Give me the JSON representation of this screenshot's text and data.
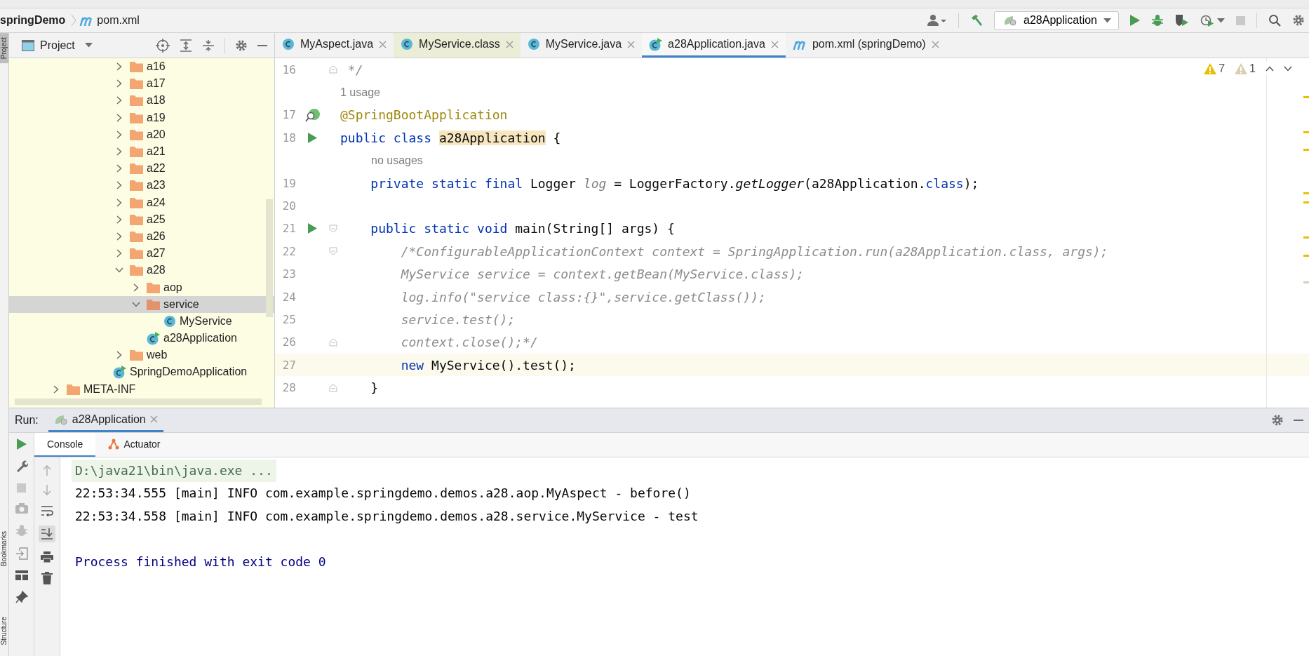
{
  "navbar": {
    "breadcrumbs": [
      {
        "label": "springDemo",
        "kind": "project"
      },
      {
        "label": "pom.xml",
        "kind": "maven"
      }
    ],
    "run_config": {
      "label": "a28Application"
    }
  },
  "side_stripe": {
    "top": [
      {
        "label": "Project",
        "selected": true
      }
    ],
    "bottom": [
      {
        "label": "Bookmarks",
        "selected": false
      },
      {
        "label": "Structure",
        "selected": false
      }
    ]
  },
  "project_panel": {
    "title": "Project",
    "tree_sections": [
      {
        "items": [
          {
            "label": "a16",
            "kind": "folder",
            "expanded": false,
            "selected": false
          },
          {
            "label": "a17",
            "kind": "folder",
            "expanded": false,
            "selected": false
          },
          {
            "label": "a18",
            "kind": "folder",
            "expanded": false,
            "selected": false
          },
          {
            "label": "a19",
            "kind": "folder",
            "expanded": false,
            "selected": false
          },
          {
            "label": "a20",
            "kind": "folder",
            "expanded": false,
            "selected": false
          },
          {
            "label": "a21",
            "kind": "folder",
            "expanded": false,
            "selected": false
          },
          {
            "label": "a22",
            "kind": "folder",
            "expanded": false,
            "selected": false
          },
          {
            "label": "a23",
            "kind": "folder",
            "expanded": false,
            "selected": false
          },
          {
            "label": "a24",
            "kind": "folder",
            "expanded": false,
            "selected": false
          },
          {
            "label": "a25",
            "kind": "folder",
            "expanded": false,
            "selected": false
          },
          {
            "label": "a26",
            "kind": "folder",
            "expanded": false,
            "selected": false
          },
          {
            "label": "a27",
            "kind": "folder",
            "expanded": false,
            "selected": false
          },
          {
            "label": "a28",
            "kind": "folder",
            "expanded": true,
            "selected": false,
            "children": [
              {
                "label": "aop",
                "kind": "folder",
                "expanded": false,
                "selected": false
              },
              {
                "label": "service",
                "kind": "folder",
                "expanded": true,
                "selected": true,
                "children": [
                  {
                    "label": "MyService",
                    "kind": "class",
                    "selected": false
                  }
                ]
              },
              {
                "label": "a28Application",
                "kind": "app",
                "selected": false
              }
            ]
          },
          {
            "label": "web",
            "kind": "folder",
            "expanded": false,
            "selected": false
          }
        ]
      },
      {
        "items": [
          {
            "label": "SpringDemoApplication",
            "kind": "app",
            "selected": false
          }
        ]
      },
      {
        "items": [
          {
            "label": "META-INF",
            "kind": "folder",
            "expanded": false,
            "selected": false
          }
        ]
      }
    ]
  },
  "editor": {
    "tabs": [
      {
        "label": "MyAspect.java",
        "kind": "class",
        "selected": false,
        "library": false
      },
      {
        "label": "MyService.class",
        "kind": "class",
        "selected": false,
        "library": true
      },
      {
        "label": "MyService.java",
        "kind": "class",
        "selected": false,
        "library": false
      },
      {
        "label": "a28Application.java",
        "kind": "app",
        "selected": true,
        "library": false
      },
      {
        "label": "pom.xml (springDemo)",
        "kind": "maven",
        "selected": false,
        "library": false
      }
    ],
    "problems": [
      {
        "count": "7",
        "kind": "warning"
      },
      {
        "count": "1",
        "kind": "weak"
      }
    ],
    "lines": [
      {
        "kind": "code",
        "number": "16",
        "fold": {
          "kind": "end"
        },
        "current": false,
        "tokens": [
          {
            "text": " */",
            "kind": "comment"
          }
        ]
      },
      {
        "kind": "hint",
        "text": "1 usage",
        "indented": false
      },
      {
        "kind": "code",
        "number": "17",
        "gutter": {
          "kind": "bean"
        },
        "current": false,
        "tokens": [
          {
            "text": "@SpringBootApplication",
            "kind": "annotation"
          }
        ]
      },
      {
        "kind": "code",
        "number": "18",
        "gutter": {
          "kind": "run"
        },
        "current": false,
        "tokens": [
          {
            "text": "public class ",
            "kind": "keyword"
          },
          {
            "text": "a28Application",
            "kind": "highlight"
          },
          {
            "text": " {",
            "kind": "plain"
          }
        ]
      },
      {
        "kind": "hint",
        "text": "no usages",
        "indented": true
      },
      {
        "kind": "code",
        "number": "19",
        "current": false,
        "tokens": [
          {
            "text": "    private static final ",
            "kind": "keyword"
          },
          {
            "text": "Logger ",
            "kind": "plain"
          },
          {
            "text": "log",
            "kind": "field"
          },
          {
            "text": " = LoggerFactory.",
            "kind": "plain"
          },
          {
            "text": "getLogger",
            "kind": "static"
          },
          {
            "text": "(a28Application.",
            "kind": "plain"
          },
          {
            "text": "class",
            "kind": "keyword"
          },
          {
            "text": ");",
            "kind": "plain"
          }
        ]
      },
      {
        "kind": "code",
        "number": "20",
        "current": false
      },
      {
        "kind": "code",
        "number": "21",
        "gutter": {
          "kind": "run"
        },
        "fold": {
          "kind": "start"
        },
        "current": false,
        "tokens": [
          {
            "text": "    public static void ",
            "kind": "keyword"
          },
          {
            "text": "main(String[] args) {",
            "kind": "plain"
          }
        ]
      },
      {
        "kind": "code",
        "number": "22",
        "fold": {
          "kind": "start"
        },
        "current": false,
        "tokens": [
          {
            "text": "        /*ConfigurableApplicationContext context = SpringApplication.run(a28Application.class, args);",
            "kind": "comment"
          }
        ]
      },
      {
        "kind": "code",
        "number": "23",
        "current": false,
        "tokens": [
          {
            "text": "        MyService service = context.getBean(MyService.class);",
            "kind": "comment"
          }
        ]
      },
      {
        "kind": "code",
        "number": "24",
        "current": false,
        "tokens": [
          {
            "text": "        log.info(\"service class:{}\",service.getClass());",
            "kind": "comment"
          }
        ]
      },
      {
        "kind": "code",
        "number": "25",
        "current": false,
        "tokens": [
          {
            "text": "        service.test();",
            "kind": "comment"
          }
        ]
      },
      {
        "kind": "code",
        "number": "26",
        "fold": {
          "kind": "end"
        },
        "current": false,
        "tokens": [
          {
            "text": "        context.close();*/",
            "kind": "comment"
          }
        ]
      },
      {
        "kind": "code",
        "number": "27",
        "current": true,
        "tokens": [
          {
            "text": "        new ",
            "kind": "keyword"
          },
          {
            "text": "MyService().test();",
            "kind": "plain"
          }
        ]
      },
      {
        "kind": "code",
        "number": "28",
        "fold": {
          "kind": "end"
        },
        "current": false,
        "tokens": [
          {
            "text": "    }",
            "kind": "plain"
          }
        ]
      }
    ]
  },
  "run_panel": {
    "label": "Run:",
    "tab": {
      "label": "a28Application",
      "selected": true
    },
    "subtabs": [
      {
        "label": "Console",
        "kind": "plain",
        "selected": true
      },
      {
        "label": "Actuator",
        "kind": "actuator",
        "selected": false
      }
    ],
    "console": [
      {
        "text": "D:\\java21\\bin\\java.exe ...",
        "kind": "command"
      },
      {
        "text": "22:53:34.555 [main] INFO com.example.springdemo.demos.a28.aop.MyAspect - before()",
        "kind": "log"
      },
      {
        "text": "22:53:34.558 [main] INFO com.example.springdemo.demos.a28.service.MyService - test",
        "kind": "log"
      },
      {
        "text": "Process finished with exit code 0",
        "kind": "exit"
      }
    ]
  }
}
